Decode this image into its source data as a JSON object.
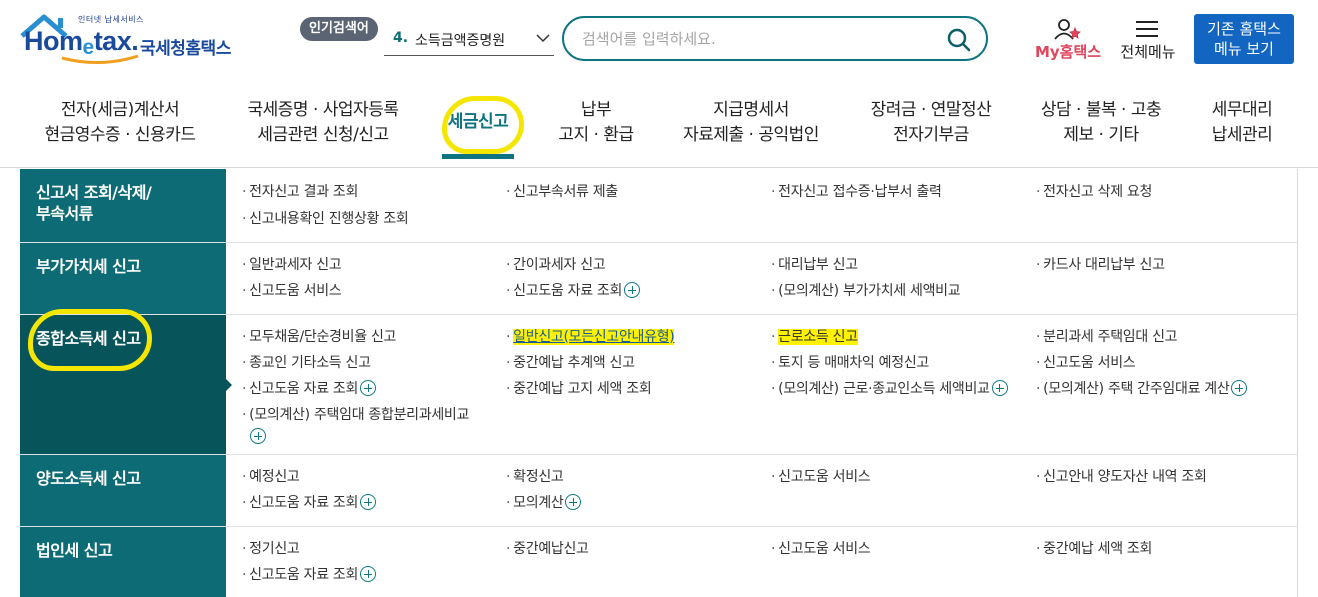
{
  "header": {
    "logo_tagline": "인터넷 납세서비스",
    "logo_word_left": "Hom",
    "logo_word_e": "e",
    "logo_word_right": "tax.",
    "logo_kr": "국세청홈택스",
    "popular_badge": "인기검색어",
    "popular_rank": "4.",
    "popular_term": "소득금액증명원",
    "search_placeholder": "검색어를 입력하세요.",
    "my_hometax": "My홈택스",
    "all_menu": "전체메뉴",
    "legacy_line1": "기존 홈택스",
    "legacy_line2": "메뉴 보기"
  },
  "nav": {
    "items": [
      {
        "line1": "전자(세금)계산서",
        "line2": "현금영수증 · 신용카드"
      },
      {
        "line1": "국세증명 · 사업자등록",
        "line2": "세금관련 신청/신고"
      },
      {
        "line1": "세금신고",
        "line2": ""
      },
      {
        "line1": "납부",
        "line2": "고지 · 환급"
      },
      {
        "line1": "지급명세서",
        "line2": "자료제출 · 공익법인"
      },
      {
        "line1": "장려금 · 연말정산",
        "line2": "전자기부금"
      },
      {
        "line1": "상담 · 불복 · 고충",
        "line2": "제보 · 기타"
      },
      {
        "line1": "세무대리",
        "line2": "납세관리"
      }
    ]
  },
  "menu": {
    "categories": [
      {
        "line1": "신고서 조회/삭제/",
        "line2": "부속서류",
        "links": [
          "전자신고 결과 조회",
          "신고부속서류 제출",
          "전자신고 접수증·납부서 출력",
          "전자신고 삭제 요청",
          "신고내용확인 진행상황 조회"
        ]
      },
      {
        "line1": "부가가치세 신고",
        "line2": "",
        "links": [
          "일반과세자 신고",
          "간이과세자 신고",
          "대리납부 신고",
          "카드사 대리납부 신고",
          "신고도움 서비스",
          "신고도움 자료 조회",
          "(모의계산) 부가가치세 세액비교"
        ]
      },
      {
        "line1": "종합소득세 신고",
        "line2": "",
        "links": [
          "모두채움/단순경비율 신고",
          "일반신고(모든신고안내유형)",
          "근로소득 신고",
          "분리과세 주택임대 신고",
          "종교인 기타소득 신고",
          "중간예납 추계액 신고",
          "토지 등 매매차익 예정신고",
          "신고도움 서비스",
          "신고도움 자료 조회",
          "중간예납 고지 세액 조회",
          "(모의계산) 근로·종교인소득 세액비교",
          "(모의계산) 주택 간주임대료 계산",
          "(모의계산) 주택임대 종합분리과세비교"
        ]
      },
      {
        "line1": "양도소득세 신고",
        "line2": "",
        "links": [
          "예정신고",
          "확정신고",
          "신고도움 서비스",
          "신고안내 양도자산 내역 조회",
          "신고도움 자료 조회",
          "모의계산"
        ]
      },
      {
        "line1": "법인세 신고",
        "line2": "",
        "links": [
          "정기신고",
          "중간예납신고",
          "신고도움 서비스",
          "중간예납 세액 조회",
          "신고도움 자료 조회"
        ]
      }
    ]
  },
  "colors": {
    "brand_teal": "#0c6b74",
    "active_teal": "#08545b",
    "accent_blue": "#1266c2",
    "my_pink": "#e0465e",
    "highlight_yellow": "#f5e600"
  }
}
